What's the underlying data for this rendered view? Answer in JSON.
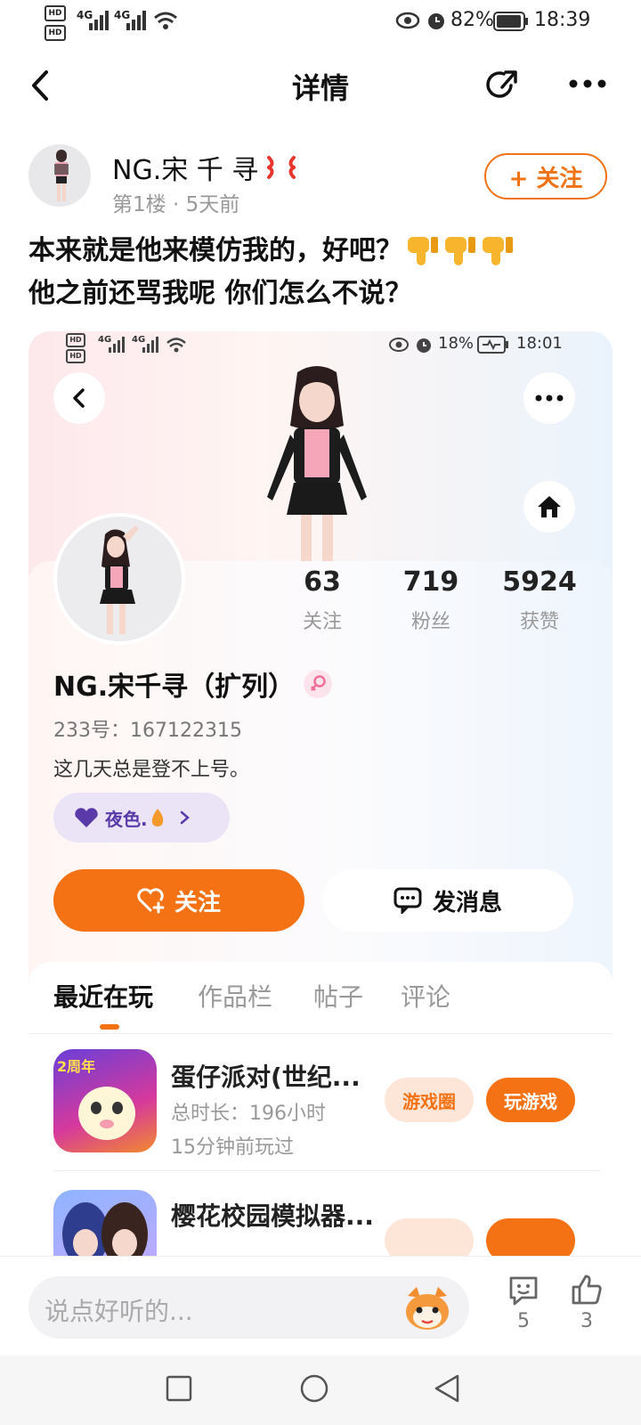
{
  "status_bar": {
    "hd1": "HD",
    "hd2": "HD",
    "net1": "4G",
    "net2": "4G",
    "battery": "82%",
    "time": "18:39"
  },
  "header": {
    "title": "详情"
  },
  "post": {
    "author": "NG.宋 千 寻",
    "floor": "第1楼",
    "time_ago": "5天前",
    "follow_label": "+ 关注",
    "text_line1": "本来就是他来模仿我的，好吧？",
    "text_line2": "他之前还骂我呢 你们怎么不说？"
  },
  "screenshot": {
    "status_bar": {
      "hd1": "HD",
      "hd2": "HD",
      "net1": "4G",
      "net2": "4G",
      "battery": "18%",
      "time": "18:01"
    },
    "stats": [
      {
        "value": "63",
        "label": "关注"
      },
      {
        "value": "719",
        "label": "粉丝"
      },
      {
        "value": "5924",
        "label": "获赞"
      }
    ],
    "name": "NG.宋千寻（扩列）",
    "id_line": "233号：167122315",
    "bio": "这几天总是登不上号。",
    "badge": "夜色.",
    "follow_button": "关注",
    "message_button": "发消息",
    "tabs": [
      "最近在玩",
      "作品栏",
      "帖子",
      "评论"
    ],
    "active_tab": "最近在玩",
    "games": [
      {
        "icon_badge": "2周年",
        "title": "蛋仔派对(世纪...",
        "duration": "总时长：196小时",
        "last_played": "15分钟前玩过",
        "circle": "游戏圈",
        "play": "玩游戏"
      },
      {
        "title": "樱花校园模拟器..."
      }
    ]
  },
  "comment_bar": {
    "placeholder": "说点好听的...",
    "comment_count": "5",
    "like_count": "3"
  },
  "colors": {
    "accent": "#f57214",
    "text": "#111111",
    "muted": "#999999"
  }
}
